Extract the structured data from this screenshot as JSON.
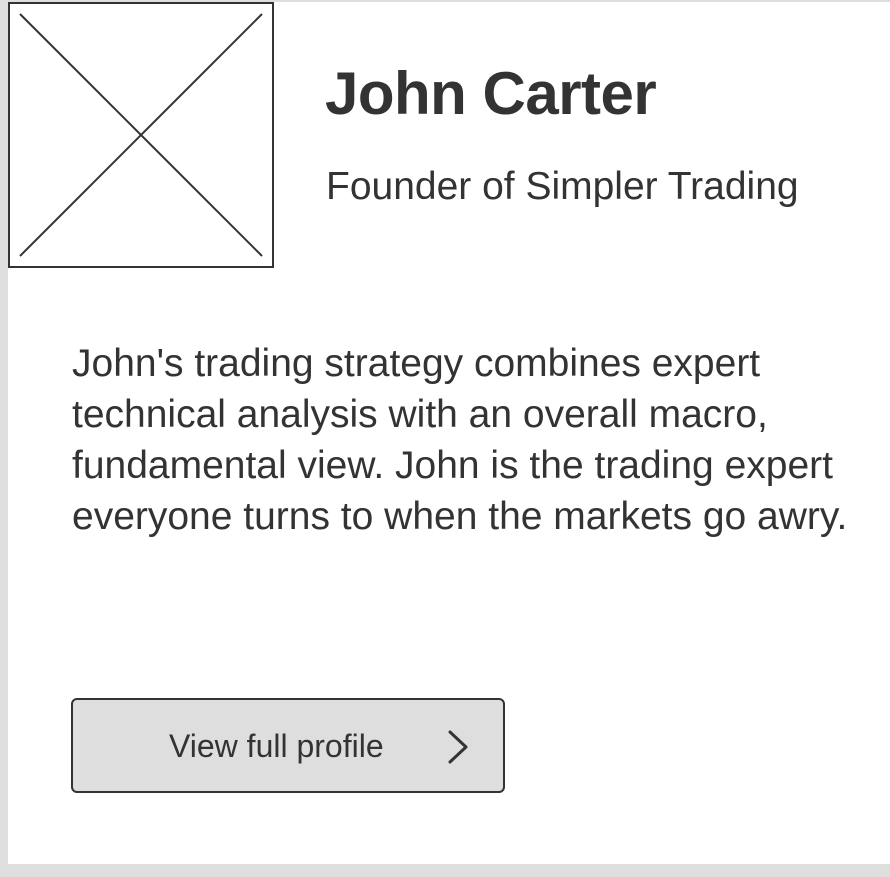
{
  "profile": {
    "name": "John Carter",
    "title": "Founder of Simpler Trading",
    "bio": "John's trading strategy combines expert technical analysis with an overall macro, fundamental view. John is the trading expert everyone turns to when the markets go awry.",
    "button_label": "View full profile",
    "button_icon": "chevron-right-icon",
    "avatar_icon": "image-placeholder-icon"
  },
  "colors": {
    "text": "#333333",
    "background": "#dedede",
    "card": "#ffffff",
    "button": "#dedede",
    "border": "#333333"
  }
}
